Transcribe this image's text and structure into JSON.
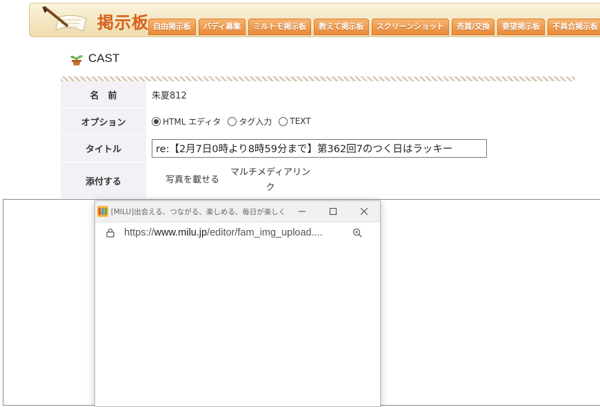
{
  "board": {
    "title": "掲示板",
    "tabs": [
      "自由掲示板",
      "バディ募集",
      "ミルトモ掲示板",
      "教えて掲示板",
      "スクリーンショット",
      "売買/交換",
      "要望掲示板",
      "不具合掲示板"
    ]
  },
  "section": {
    "title": "CAST"
  },
  "form": {
    "name_label": "名　前",
    "name_value": "朱夏812",
    "option_label": "オプション",
    "options": [
      "HTML エディタ",
      "タグ入力",
      "TEXT"
    ],
    "selected_option": "HTML エディタ",
    "title_label": "タイトル",
    "title_value": "re:【2月7日0時より8時59分まで】第362回7のつく日はラッキー",
    "attach_label": "添付する",
    "attach_photo": "写真を載せる",
    "attach_multimedia_line1": "マルチメディアリン",
    "attach_multimedia_line2": "ク"
  },
  "popup": {
    "window_title": "[MILU]出会える、つながる、楽しめる、毎日が楽しく...",
    "url_scheme": "https://",
    "url_host": "www.milu.jp",
    "url_path": "/editor/fam_img_upload....",
    "minimize": "—",
    "maximize": "☐",
    "close": "✕"
  }
}
